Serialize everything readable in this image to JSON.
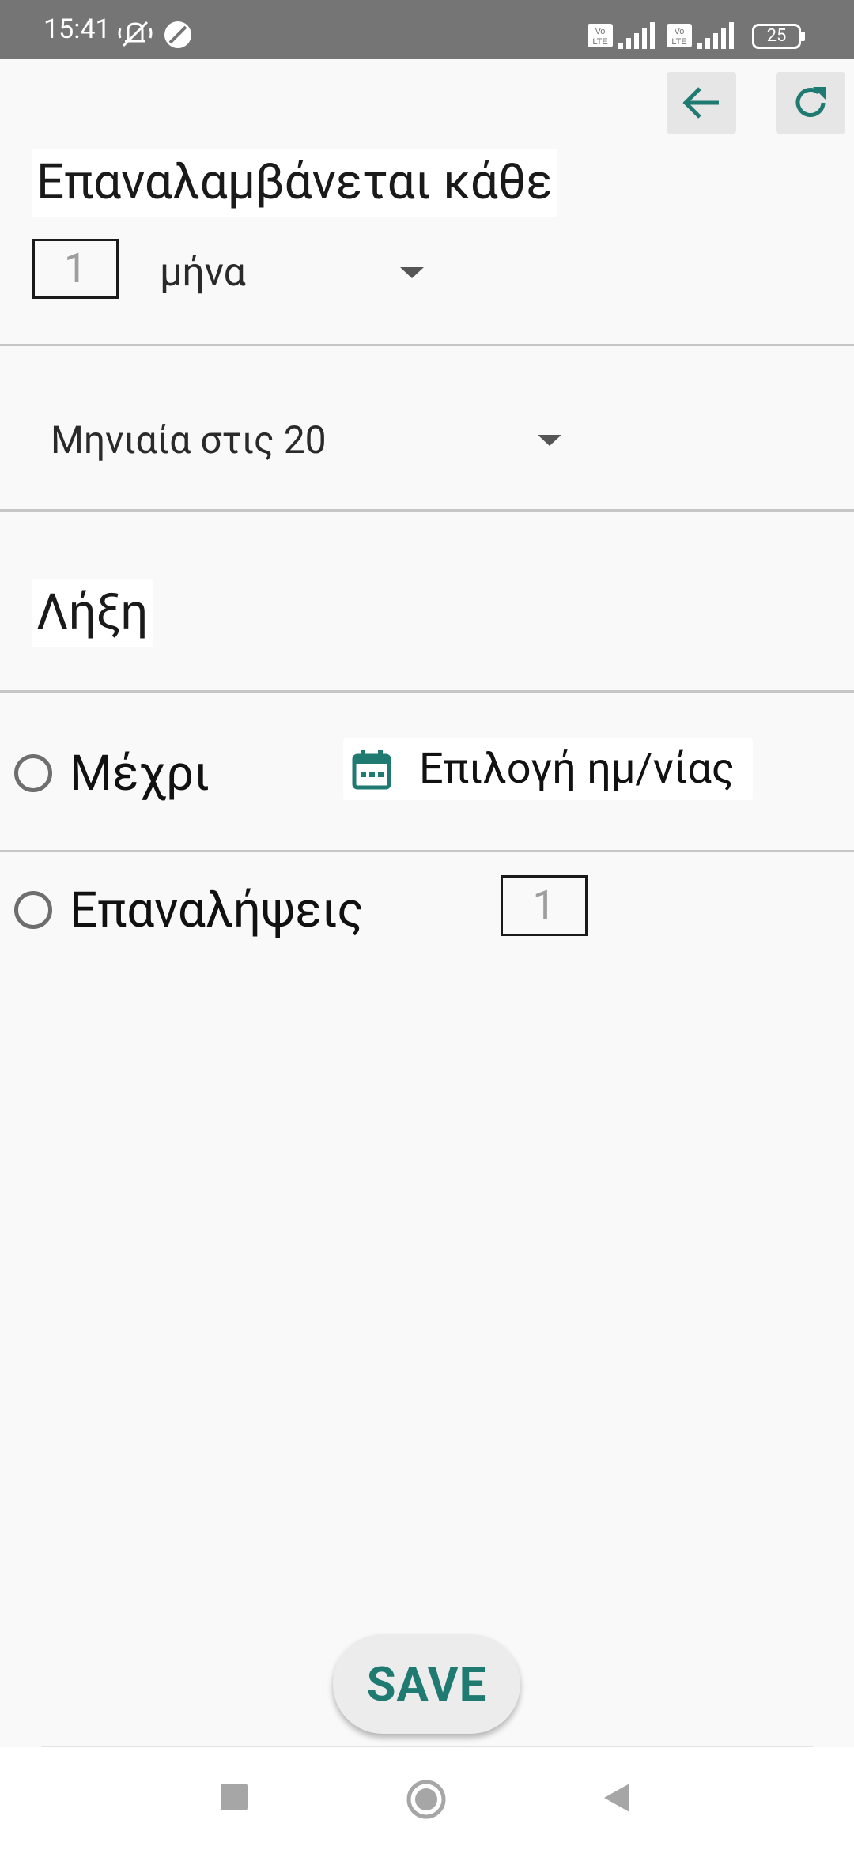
{
  "status_bar": {
    "time": "15:41",
    "battery": "25",
    "network_badge": "VoLTE",
    "icons": [
      "vibrate-off-icon",
      "data-saver-icon",
      "signal-icon",
      "battery-icon"
    ]
  },
  "toolbar": {
    "back_icon": "arrow-left-icon",
    "reset_icon": "refresh-icon",
    "accent_color": "#1f7a72"
  },
  "repeat_section": {
    "heading": "Επαναλαμβάνεται κάθε",
    "interval_placeholder": "1",
    "unit_selected": "μήνα"
  },
  "monthly_option": {
    "selected": "Μηνιαία στις 20"
  },
  "end_section": {
    "heading": "Λήξη",
    "until_label": "Μέχρι",
    "date_button_label": "Επιλογή ημ/νίας",
    "occurrences_label": "Επαναλήψεις",
    "occurrences_placeholder": "1"
  },
  "actions": {
    "save_label": "SAVE"
  },
  "nav_bar": {
    "icons": [
      "square-recents-icon",
      "circle-home-icon",
      "triangle-back-icon"
    ]
  }
}
